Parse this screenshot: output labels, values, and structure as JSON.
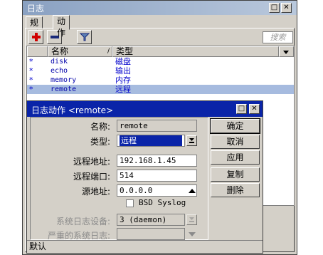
{
  "window": {
    "title": "日志",
    "controls": {
      "restore": "□",
      "close": "✕"
    }
  },
  "tabs": [
    {
      "label": "规则"
    },
    {
      "label": "动作"
    }
  ],
  "toolbar": {
    "add_icon": "plus-icon",
    "remove_icon": "minus-icon",
    "filter_icon": "funnel-icon",
    "find_placeholder": "搜索"
  },
  "list": {
    "columns": [
      "名称",
      "类型"
    ],
    "rows": [
      {
        "flag": "*",
        "name": "disk",
        "type": "磁盘",
        "selected": false
      },
      {
        "flag": "*",
        "name": "echo",
        "type": "输出",
        "selected": false
      },
      {
        "flag": "*",
        "name": "memory",
        "type": "内存",
        "selected": false
      },
      {
        "flag": "*",
        "name": "remote",
        "type": "远程",
        "selected": true
      }
    ]
  },
  "dialog": {
    "title": "日志动作 <remote>",
    "controls": {
      "restore": "□",
      "close": "✕"
    },
    "fields": {
      "name_label": "名称:",
      "name_value": "remote",
      "type_label": "类型:",
      "type_value": "远程",
      "remote_address_label": "远程地址:",
      "remote_address_value": "192.168.1.45",
      "remote_port_label": "远程端口:",
      "remote_port_value": "514",
      "src_address_label": "源地址:",
      "src_address_value": "0.0.0.0",
      "bsd_syslog_label": "BSD Syslog",
      "bsd_syslog_checked": false,
      "syslog_facility_label": "系统日志设备:",
      "syslog_facility_value": "3 (daemon)",
      "syslog_severity_label": "严重的系统日志:",
      "syslog_severity_value": ""
    },
    "buttons": {
      "ok": "确定",
      "cancel": "取消",
      "apply": "应用",
      "copy": "复制",
      "remove": "删除"
    },
    "status": "默认"
  },
  "colors": {
    "title_inactive": "#8aa1c2",
    "title_active": "#0a24a8",
    "selection": "#a6bbdf",
    "list_text": "#0000cc",
    "face": "#d4d0c8"
  }
}
